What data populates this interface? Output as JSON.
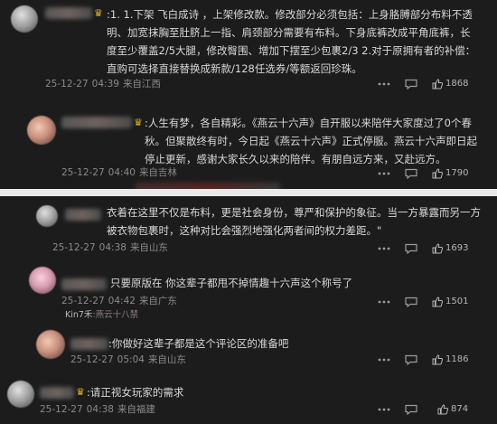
{
  "comments": [
    {
      "text": ":1. 1.下架 飞白成诗 ，上架修改款。修改部分必须包括：上身胳膊部分布料不透明、加宽抹胸至肚脐上一指、肩颈部分需要有布料。下身底裤改成平角底裤，长度至少覆盖2/5大腿，修改臀围、增加下摆至少包裹2/3 2.对于原拥有者的补偿：直购可选择直接替换成新款/128任选券/等额返回珍珠。",
      "date": "25-12-27",
      "time": "04:39",
      "location": "来自江西",
      "likes": "1868"
    },
    {
      "text": ":人生有梦，各自精彩。《燕云十六声》自开服以来陪伴大家度过了0个春秋。但聚散终有时，今日起《燕云十六声》正式停服。燕云十六声即日起停止更新，感谢大家长久以来的陪伴。有朋自远方来，又赴远方。",
      "date": "25-12-27",
      "time": "04:40",
      "location": "来自吉林",
      "likes": "1790"
    },
    {
      "text": "衣着在这里不仅是布料，更是社会身份，尊严和保护的象征。当一方暴露而另一方被衣物包裹时，这种对比会强烈地强化两者间的权力差距。\"",
      "date": "25-12-27",
      "time": "04:38",
      "location": "来自山东",
      "likes": "1693"
    },
    {
      "text": "只要原版在 你这辈子都甩不掉情趣十六声这个称号了",
      "date": "25-12-27",
      "time": "04:42",
      "location": "来自广东",
      "likes": "1501",
      "peek_name": "Kin7禾",
      "peek_text": ":燕云十八禁"
    },
    {
      "text": ":你做好这辈子都是这个评论区的准备吧",
      "date": "25-12-27",
      "time": "05:04",
      "location": "来自山东",
      "likes": "1186"
    },
    {
      "text": ":请正视女玩家的需求",
      "date": "25-12-27",
      "time": "04:38",
      "location": "来自福建",
      "likes": "874"
    }
  ],
  "colors": {
    "background": "#1c1c1c",
    "text": "#d8d8d8",
    "meta": "#8a8a8a",
    "crown": "#e6b422"
  }
}
